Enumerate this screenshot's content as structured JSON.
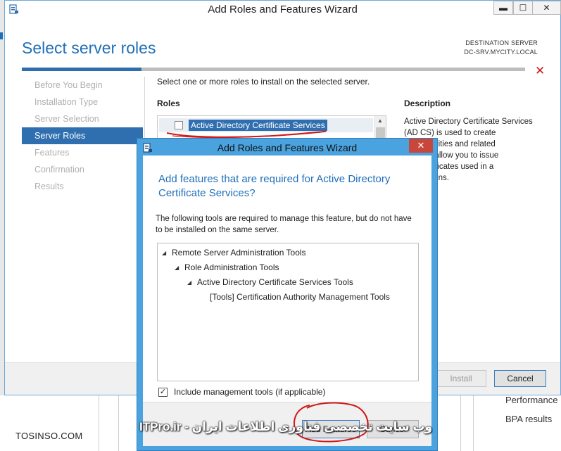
{
  "main_window": {
    "title": "Add Roles and Features Wizard",
    "heading": "Select server roles",
    "destination_label": "DESTINATION SERVER",
    "destination_server": "DC-SRV.MYCITY.LOCAL",
    "nav_items": [
      {
        "label": "Before You Begin",
        "active": false
      },
      {
        "label": "Installation Type",
        "active": false
      },
      {
        "label": "Server Selection",
        "active": false
      },
      {
        "label": "Server Roles",
        "active": true
      },
      {
        "label": "Features",
        "active": false
      },
      {
        "label": "Confirmation",
        "active": false
      },
      {
        "label": "Results",
        "active": false
      }
    ],
    "instruction": "Select one or more roles to install on the selected server.",
    "roles_heading": "Roles",
    "selected_role": "Active Directory Certificate Services",
    "description_heading": "Description",
    "description_lines": [
      "Active Directory Certificate Services",
      "(AD CS) is used to create",
      "on authorities and related",
      "ces that allow you to issue",
      "age certificates used in a",
      "applications."
    ],
    "install_label": "Install",
    "cancel_label": "Cancel"
  },
  "dialog": {
    "title": "Add Roles and Features Wizard",
    "heading": "Add features that are required for Active Directory Certificate Services?",
    "text": "The following tools are required to manage this feature, but do not have to be installed on the same server.",
    "tree": [
      {
        "label": "Remote Server Administration Tools",
        "expanded": true
      },
      {
        "label": "Role Administration Tools",
        "expanded": true
      },
      {
        "label": "Active Directory Certificate Services Tools",
        "expanded": true
      },
      {
        "label": "[Tools] Certification Authority Management Tools",
        "expanded": false
      }
    ],
    "include_tools_label": "Include management tools (if applicable)",
    "include_tools_checked": true,
    "add_features_label": "Add Features",
    "cancel_label": "Cancel"
  },
  "background": {
    "performance_label": "Performance",
    "bpa_label": "BPA results"
  },
  "watermarks": {
    "left": "TOSINSO.COM",
    "persian": "وب سایت تخصصی فناوری اطلاعات ایران - ITPro.ir"
  },
  "colors": {
    "accent_blue": "#1f6fb8",
    "nav_active": "#2f6fb0",
    "dialog_frame": "#4aa3df",
    "annotation_red": "#d01818"
  }
}
